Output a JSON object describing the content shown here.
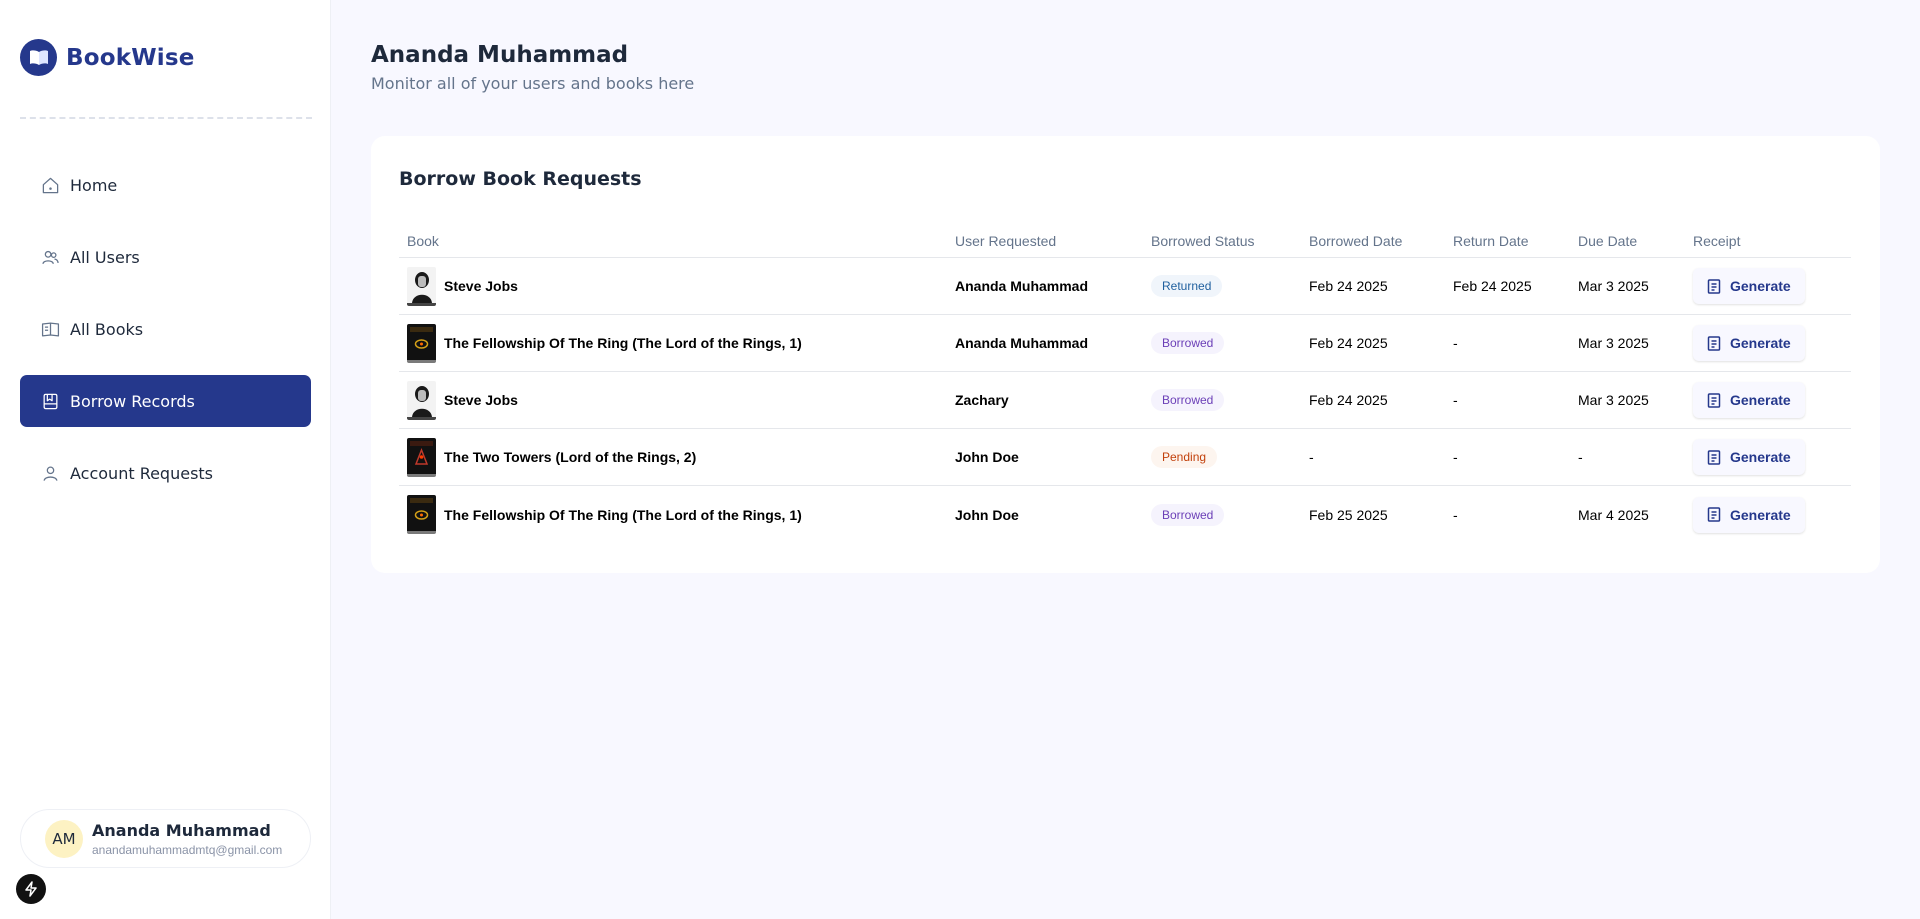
{
  "app": {
    "name": "BookWise"
  },
  "sidebar": {
    "items": [
      {
        "label": "Home",
        "icon": "home-icon",
        "active": false
      },
      {
        "label": "All Users",
        "icon": "users-icon",
        "active": false
      },
      {
        "label": "All Books",
        "icon": "book-open-icon",
        "active": false
      },
      {
        "label": "Borrow Records",
        "icon": "bookmark-box-icon",
        "active": true
      },
      {
        "label": "Account Requests",
        "icon": "user-icon",
        "active": false
      }
    ],
    "user": {
      "initials": "AM",
      "name": "Ananda Muhammad",
      "email": "anandamuhammadmtq@gmail.com"
    }
  },
  "header": {
    "title": "Ananda Muhammad",
    "subtitle": "Monitor all of your users and books here"
  },
  "table": {
    "title": "Borrow Book Requests",
    "columns": [
      "Book",
      "User Requested",
      "Borrowed Status",
      "Borrowed Date",
      "Return Date",
      "Due Date",
      "Receipt"
    ],
    "rows": [
      {
        "book": "Steve Jobs",
        "user": "Ananda Muhammad",
        "status": "Returned",
        "borrowed": "Feb 24 2025",
        "returned": "Feb 24 2025",
        "due": "Mar 3 2025",
        "receipt": "Generate"
      },
      {
        "book": "The Fellowship Of The Ring (The Lord of the Rings, 1)",
        "user": "Ananda Muhammad",
        "status": "Borrowed",
        "borrowed": "Feb 24 2025",
        "returned": "-",
        "due": "Mar 3 2025",
        "receipt": "Generate"
      },
      {
        "book": "Steve Jobs",
        "user": "Zachary",
        "status": "Borrowed",
        "borrowed": "Feb 24 2025",
        "returned": "-",
        "due": "Mar 3 2025",
        "receipt": "Generate"
      },
      {
        "book": "The Two Towers (Lord of the Rings, 2)",
        "user": "John Doe",
        "status": "Pending",
        "borrowed": "-",
        "returned": "-",
        "due": "-",
        "receipt": "Generate"
      },
      {
        "book": "The Fellowship Of The Ring (The Lord of the Rings, 1)",
        "user": "John Doe",
        "status": "Borrowed",
        "borrowed": "Feb 25 2025",
        "returned": "-",
        "due": "Mar 4 2025",
        "receipt": "Generate"
      }
    ]
  },
  "colors": {
    "brand": "#25388c",
    "returned": "#1f5f9e",
    "borrowed": "#6b3fb7",
    "pending": "#c2410c"
  }
}
